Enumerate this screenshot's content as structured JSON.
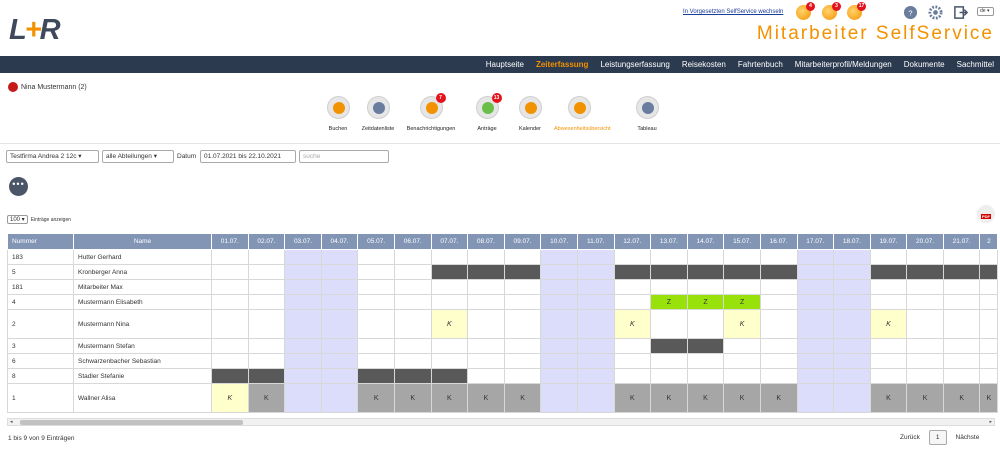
{
  "logo": {
    "text_left": "L",
    "text_mid": "+",
    "text_right": "R"
  },
  "header": {
    "proxy_link": "In Vorgesetzten SelfService wechseln",
    "lang": "de",
    "brand": "Mitarbeiter SelfService",
    "notifications": [
      {
        "icon": "bell-icon",
        "count": "4"
      },
      {
        "icon": "bell-icon",
        "count": "3"
      },
      {
        "icon": "bell-icon",
        "count": "17"
      }
    ],
    "tools": [
      "help-icon",
      "gear-icon",
      "logout-icon"
    ]
  },
  "nav": {
    "items": [
      "Hauptseite",
      "Zeiterfassung",
      "Leistungserfassung",
      "Reisekosten",
      "Fahrtenbuch",
      "Mitarbeiterprofil/Meldungen",
      "Dokumente",
      "Sachmittel"
    ],
    "active": "Zeiterfassung"
  },
  "user": {
    "name": "Nina Mustermann (2)"
  },
  "toolbar": {
    "items": [
      {
        "label": "Buchen",
        "count": "",
        "color": "#f39200"
      },
      {
        "label": "Zeitdatenliste",
        "count": "",
        "color": "#6a7d9e"
      },
      {
        "label": "Benachrichtigungen",
        "count": "7",
        "color": "#f39200"
      },
      {
        "label": "Anträge",
        "count": "13",
        "color": "#6abf4b"
      },
      {
        "label": "Kalender",
        "count": "",
        "color": "#f39200"
      },
      {
        "label": "Abwesenheitsübersicht",
        "count": "",
        "color": "#f39200"
      },
      {
        "label": "Tableau",
        "count": "",
        "color": "#6a7d9e"
      }
    ],
    "active": "Abwesenheitsübersicht"
  },
  "filters": {
    "company": "Testfirma Andrea 2 12c",
    "department": "alle Abteilungen",
    "date_label": "Datum",
    "date_range": "01.07.2021 bis 22.10.2021",
    "search_placeholder": "suche"
  },
  "table": {
    "length_value": "100",
    "length_label": "Einträge anzeigen",
    "col_number": "Nummer",
    "col_name": "Name",
    "dates": [
      "01.07.",
      "02.07.",
      "03.07.",
      "04.07.",
      "05.07.",
      "06.07.",
      "07.07.",
      "08.07.",
      "09.07.",
      "10.07.",
      "11.07.",
      "12.07.",
      "13.07.",
      "14.07.",
      "15.07.",
      "16.07.",
      "17.07.",
      "18.07.",
      "19.07.",
      "20.07.",
      "21.07.",
      "2"
    ],
    "weekend_cols": [
      2,
      3,
      9,
      10,
      16,
      17
    ],
    "rows": [
      {
        "nr": "183",
        "name": "Hutter Gerhard",
        "cells": {}
      },
      {
        "nr": "5",
        "name": "Kronberger Anna",
        "cells": {
          "6": [
            "dk",
            ""
          ],
          "7": [
            "dk",
            ""
          ],
          "8": [
            "dk",
            ""
          ],
          "11": [
            "dk",
            ""
          ],
          "12": [
            "dk",
            ""
          ],
          "13": [
            "dk",
            ""
          ],
          "14": [
            "dk",
            ""
          ],
          "15": [
            "dk",
            ""
          ],
          "18": [
            "dk",
            ""
          ],
          "19": [
            "dk",
            ""
          ],
          "20": [
            "dk",
            ""
          ],
          "21": [
            "dk",
            ""
          ]
        }
      },
      {
        "nr": "181",
        "name": "Mitarbeiter Max",
        "cells": {}
      },
      {
        "nr": "4",
        "name": "Mustermann Elisabeth",
        "cells": {
          "12": [
            "gr",
            "Z"
          ],
          "13": [
            "gr",
            "Z"
          ],
          "14": [
            "gr",
            "Z"
          ]
        }
      },
      {
        "nr": "2",
        "name": "Mustermann Nina",
        "tall": true,
        "cells": {
          "6": [
            "yl",
            "K"
          ],
          "11": [
            "yl",
            "K"
          ],
          "14": [
            "yl",
            "K"
          ],
          "18": [
            "yl",
            "K"
          ]
        }
      },
      {
        "nr": "3",
        "name": "Mustermann Stefan",
        "cells": {
          "12": [
            "dk",
            ""
          ],
          "13": [
            "dk",
            ""
          ]
        }
      },
      {
        "nr": "6",
        "name": "Schwarzenbacher Sebastian",
        "cells": {}
      },
      {
        "nr": "8",
        "name": "Stadler Stefanie",
        "cells": {
          "0": [
            "dk",
            ""
          ],
          "1": [
            "dk",
            ""
          ],
          "4": [
            "dk",
            ""
          ],
          "5": [
            "dk",
            ""
          ],
          "6": [
            "dk",
            ""
          ]
        }
      },
      {
        "nr": "1",
        "name": "Wallner Alisa",
        "tall": true,
        "cells": {
          "0": [
            "yl",
            "K"
          ],
          "1": [
            "gy",
            "K"
          ],
          "4": [
            "gy",
            "K"
          ],
          "5": [
            "gy",
            "K"
          ],
          "6": [
            "gy",
            "K"
          ],
          "7": [
            "gy",
            "K"
          ],
          "8": [
            "gy",
            "K"
          ],
          "11": [
            "gy",
            "K"
          ],
          "12": [
            "gy",
            "K"
          ],
          "13": [
            "gy",
            "K"
          ],
          "14": [
            "gy",
            "K"
          ],
          "15": [
            "gy",
            "K"
          ],
          "18": [
            "gy",
            "K"
          ],
          "19": [
            "gy",
            "K"
          ],
          "20": [
            "gy",
            "K"
          ],
          "21": [
            "gy",
            "K"
          ]
        }
      }
    ]
  },
  "footer": {
    "info": "1 bis 9 von 9 Einträgen",
    "prev": "Zurück",
    "page": "1",
    "next": "Nächste"
  }
}
